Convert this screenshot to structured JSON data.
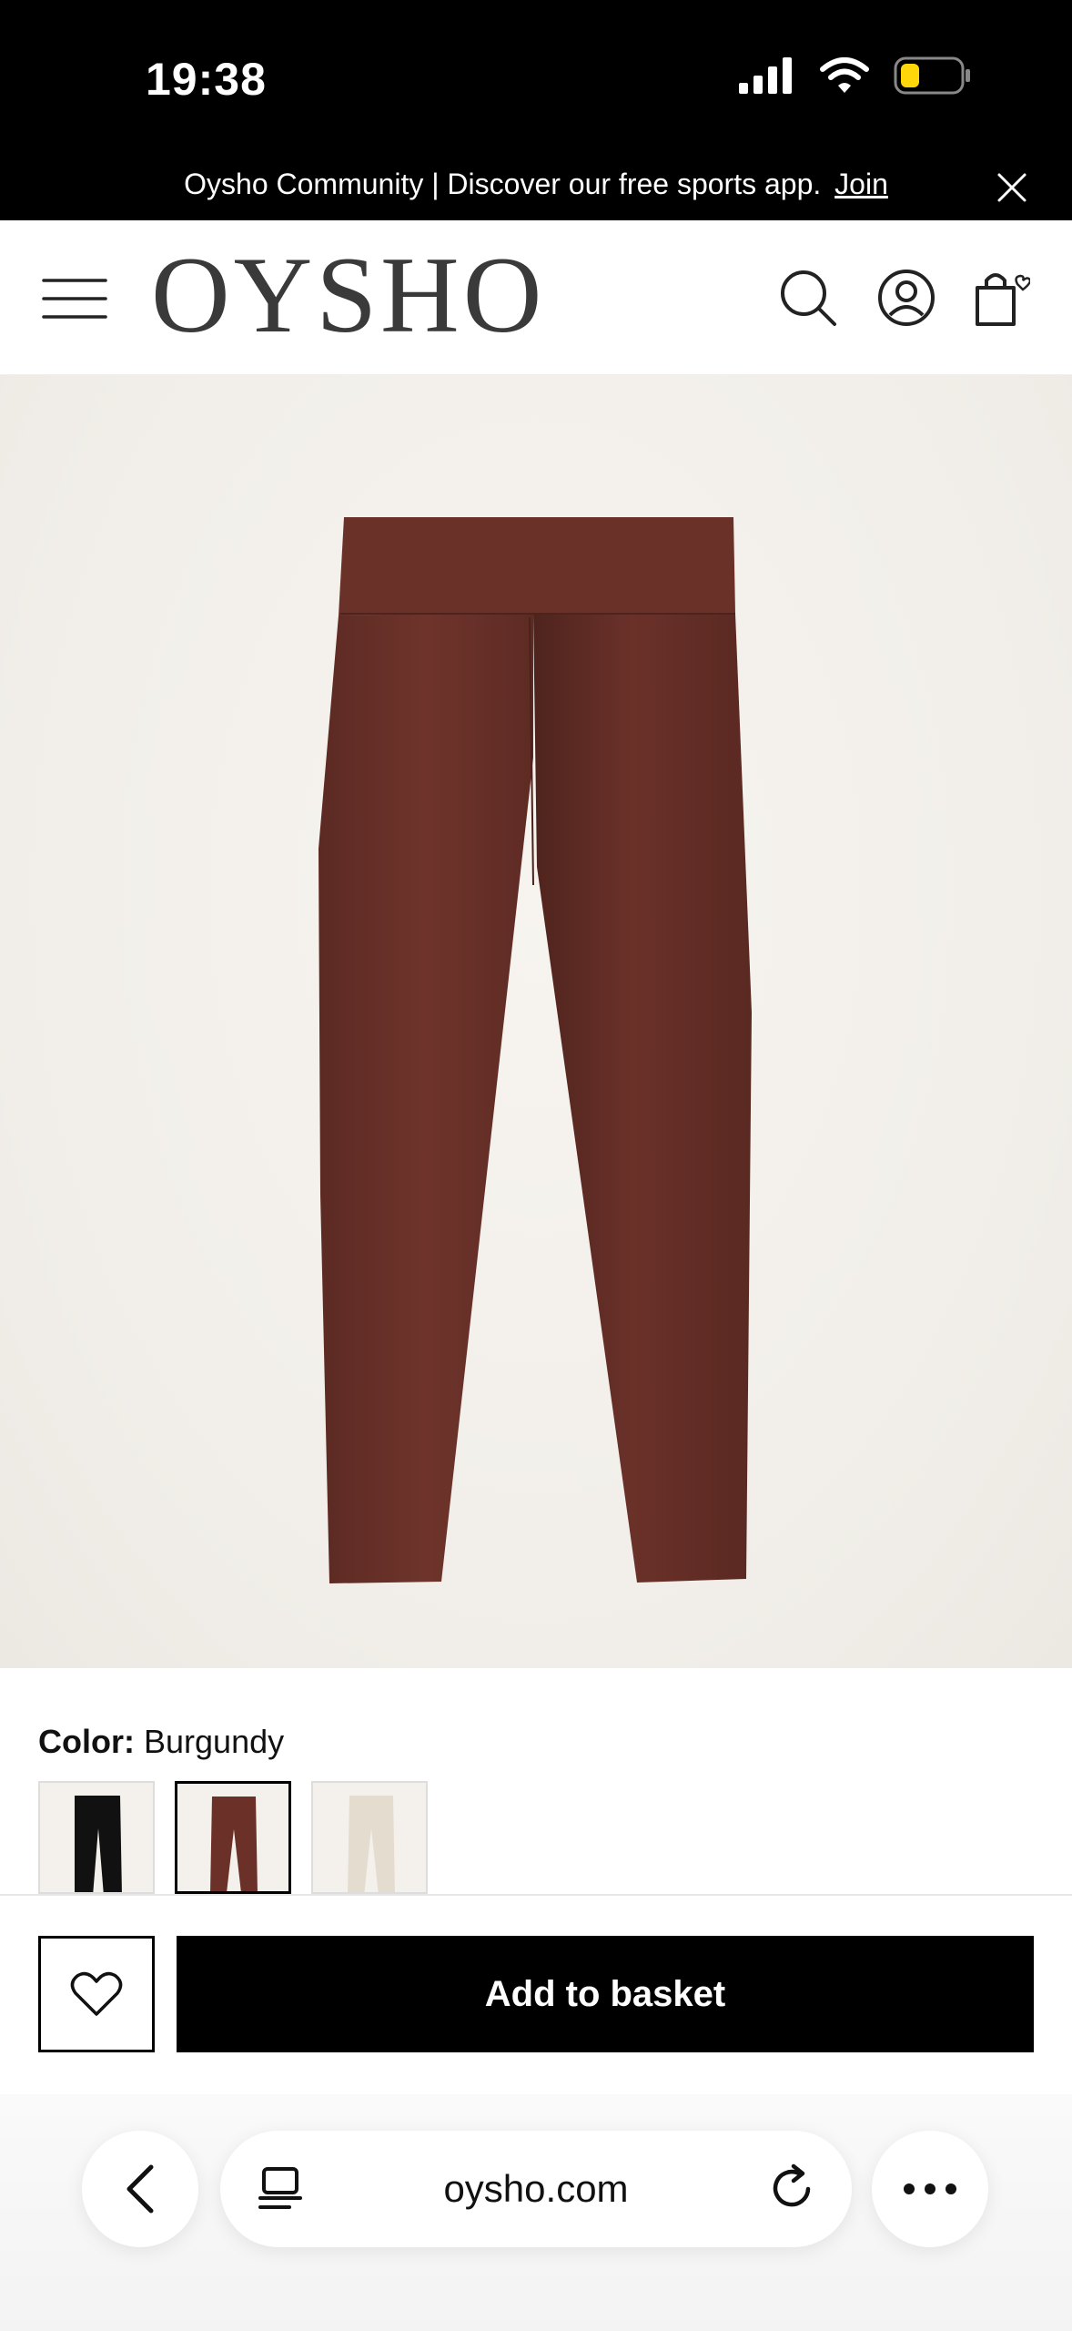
{
  "status_bar": {
    "time": "19:38",
    "icons": [
      "signal-icon",
      "wifi-icon",
      "battery-icon"
    ]
  },
  "promo": {
    "text": "Oysho Community | Discover our free sports app.",
    "link": "Join",
    "close_icon": "close-icon"
  },
  "header": {
    "logo": "OYSHO",
    "icons": [
      "menu-icon",
      "search-icon",
      "account-icon",
      "bag-icon"
    ]
  },
  "product": {
    "image_color": "#6b3129",
    "gallery_position": "4 of 4"
  },
  "color_selector": {
    "label": "Color:",
    "value": "Burgundy",
    "swatches": [
      {
        "name": "Black",
        "color": "#111111"
      },
      {
        "name": "Burgundy",
        "color": "#6b3129",
        "selected": true
      },
      {
        "name": "Ivory",
        "color": "#e9e2d8"
      }
    ]
  },
  "actions": {
    "wishlist_icon": "heart-icon",
    "add_to_basket": "Add to basket"
  },
  "browser": {
    "url": "oysho.com",
    "icons": [
      "back-icon",
      "tabs-icon",
      "reload-icon",
      "more-icon"
    ]
  },
  "colors": {
    "brand_black": "#000000",
    "background": "#f2efea"
  }
}
